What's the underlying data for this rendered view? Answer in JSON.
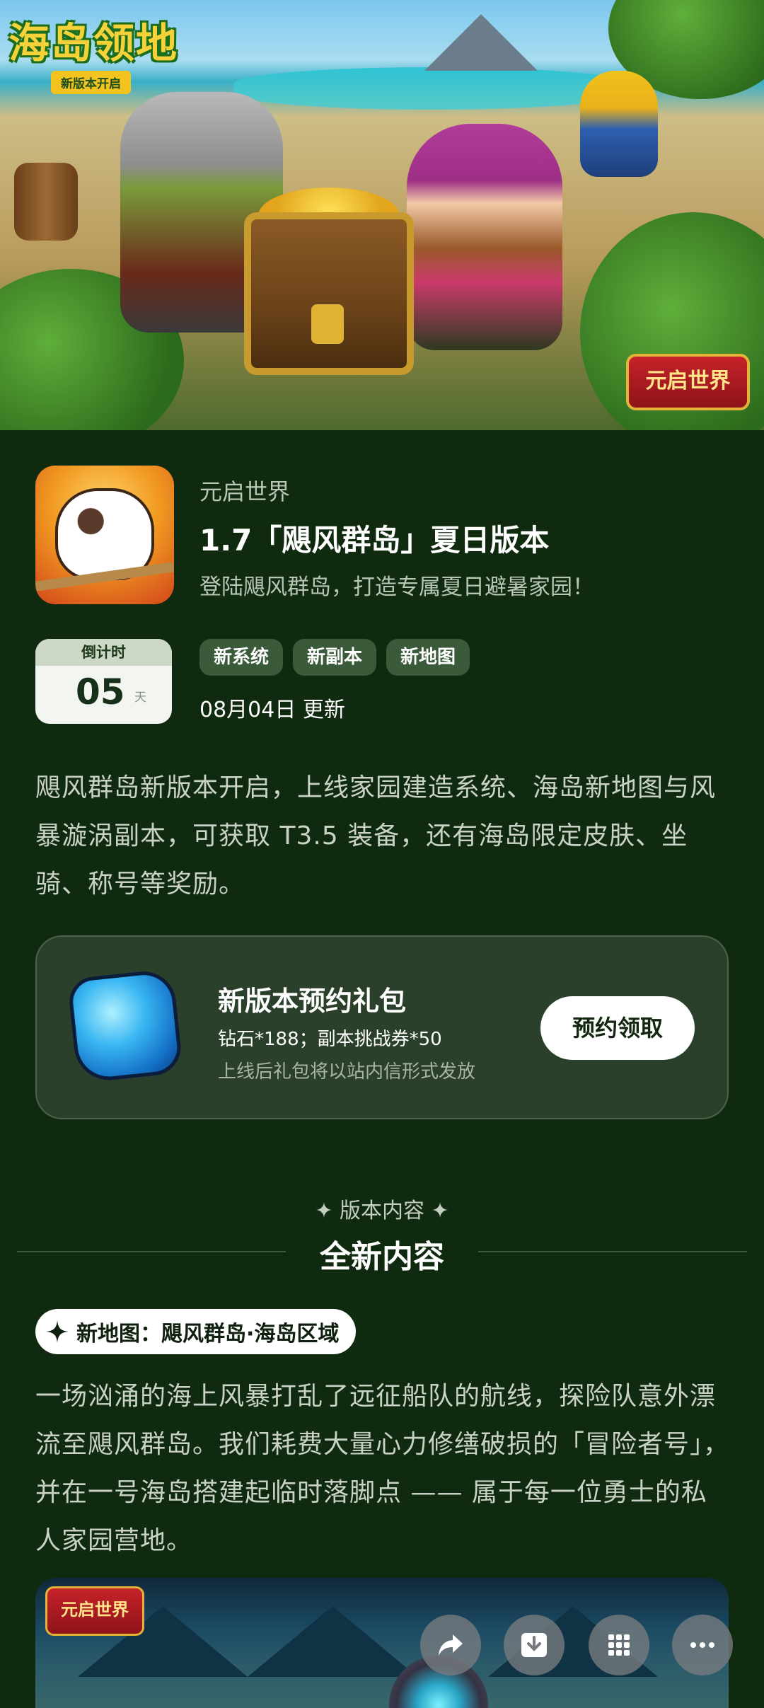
{
  "hero": {
    "logo_title": "海岛领地",
    "logo_subtitle": "新版本开启",
    "brand_badge": "元启世界"
  },
  "header": {
    "publisher": "元启世界",
    "title": "1.7「飓风群岛」夏日版本",
    "tagline": "登陆飓风群岛，打造专属夏日避暑家园！"
  },
  "countdown": {
    "label": "倒计时",
    "value": "05",
    "unit": "天"
  },
  "tags": [
    "新系统",
    "新副本",
    "新地图"
  ],
  "update_date": "08月04日 更新",
  "description": "飓风群岛新版本开启，上线家园建造系统、海岛新地图与风暴漩涡副本，可获取 T3.5 装备，还有海岛限定皮肤、坐骑、称号等奖励。",
  "reserve": {
    "title": "新版本预约礼包",
    "items": "钻石*188；副本挑战券*50",
    "note": "上线后礼包将以站内信形式发放",
    "button": "预约领取"
  },
  "section": {
    "kicker": "✦ 版本内容 ✦",
    "title": "全新内容"
  },
  "feature": {
    "label": "新地图：飓风群岛·海岛区域",
    "story": "一场汹涌的海上风暴打乱了远征船队的航线，探险队意外漂流至飓风群岛。我们耗费大量心力修缮破损的「冒险者号」，并在一号海岛搭建起临时落脚点 —— 属于每一位勇士的私人家园营地。"
  },
  "bottom_image": {
    "badge": "元启世界"
  },
  "actions": {
    "share": "share-icon",
    "download": "download-icon",
    "apps": "grid-icon",
    "more": "more-icon"
  }
}
